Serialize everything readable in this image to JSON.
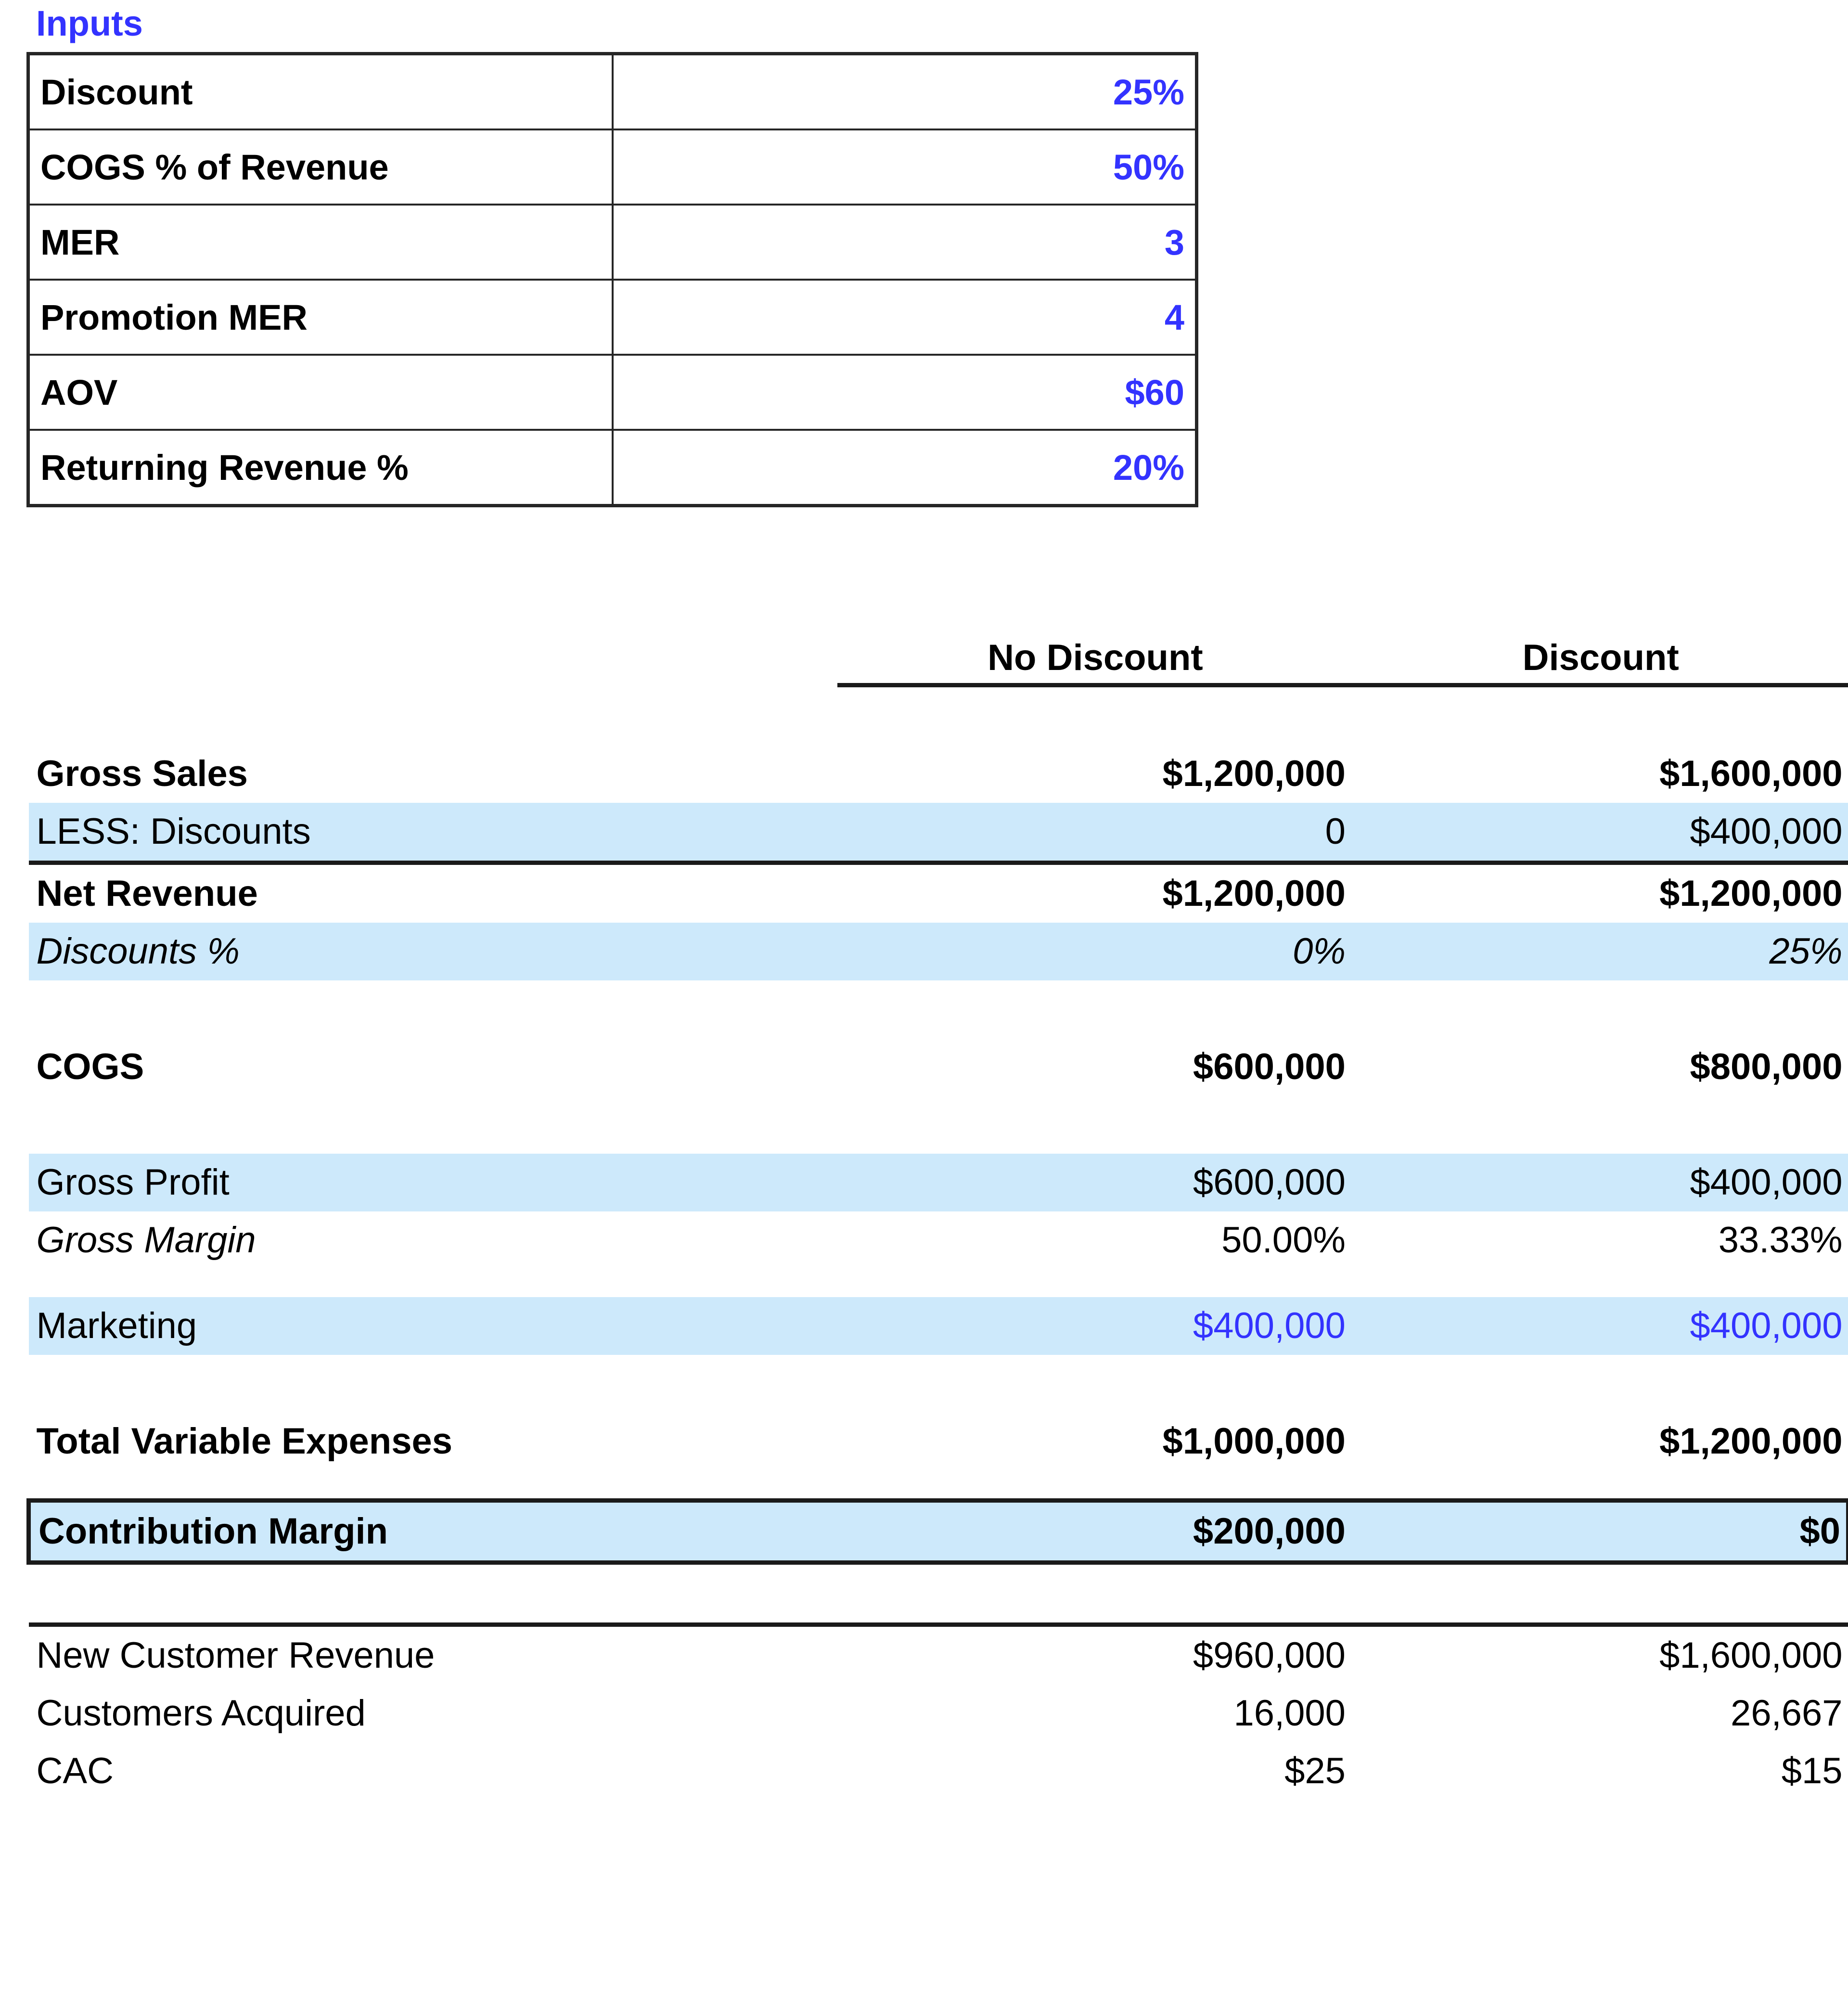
{
  "inputs": {
    "title": "Inputs",
    "rows": [
      {
        "label": "Discount",
        "value": "25%"
      },
      {
        "label": "COGS % of Revenue",
        "value": "50%"
      },
      {
        "label": "MER",
        "value": "3"
      },
      {
        "label": "Promotion MER",
        "value": "4"
      },
      {
        "label": "AOV",
        "value": "$60"
      },
      {
        "label": "Returning Revenue %",
        "value": "20%"
      }
    ]
  },
  "statement": {
    "columns": {
      "col1": "No Discount",
      "col2": "Discount"
    },
    "rows": [
      {
        "label": "Gross Sales",
        "col1": "$1,200,000",
        "col2": "$1,600,000"
      },
      {
        "label": "LESS: Discounts",
        "col1": "0",
        "col2": "$400,000"
      },
      {
        "label": "Net Revenue",
        "col1": "$1,200,000",
        "col2": "$1,200,000"
      },
      {
        "label": "Discounts %",
        "col1": "0%",
        "col2": "25%"
      },
      {
        "label": "COGS",
        "col1": "$600,000",
        "col2": "$800,000"
      },
      {
        "label": "Gross Profit",
        "col1": "$600,000",
        "col2": "$400,000"
      },
      {
        "label": "Gross Margin",
        "col1": "50.00%",
        "col2": "33.33%"
      },
      {
        "label": "Marketing",
        "col1": "$400,000",
        "col2": "$400,000"
      },
      {
        "label": "Total Variable Expenses",
        "col1": "$1,000,000",
        "col2": "$1,200,000"
      },
      {
        "label": "Contribution Margin",
        "col1": "$200,000",
        "col2": "$0"
      },
      {
        "label": "New Customer Revenue",
        "col1": "$960,000",
        "col2": "$1,600,000"
      },
      {
        "label": "Customers Acquired",
        "col1": "16,000",
        "col2": "26,667"
      },
      {
        "label": "CAC",
        "col1": "$25",
        "col2": "$15"
      }
    ]
  },
  "colors": {
    "input_value_blue": "#3333FF",
    "row_highlight_blue": "#CDE9FB",
    "border_dark": "#1a1a1a",
    "text_black": "#000000"
  }
}
